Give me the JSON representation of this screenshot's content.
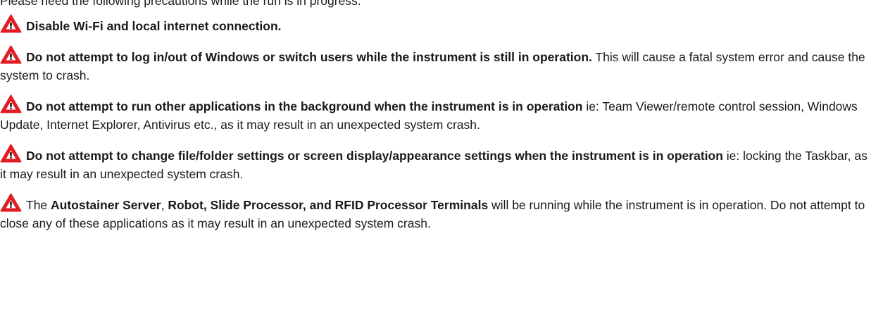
{
  "intro": "Please heed the following precautions while the run is in progress.",
  "warning_icon": "warning-triangle-icon",
  "colors": {
    "icon_fill": "#e31b23",
    "icon_mark": "#000000",
    "text": "#1a1a1a"
  },
  "warnings": [
    {
      "bold": "Disable Wi-Fi and local internet connection.",
      "rest": ""
    },
    {
      "bold": "Do not attempt to log in/out of Windows or switch users while the instrument is still in operation.",
      "rest": " This will cause a fatal system error and cause the system to crash."
    },
    {
      "bold": "Do not attempt to run other applications in the background when the instrument is in operation",
      "rest": " ie: Team Viewer/remote control session, Windows Update, Internet Explorer, Antivirus etc., as it may result in an unexpected system crash."
    },
    {
      "bold": "Do not attempt to change file/folder settings or screen display/appearance settings when the instrument is in operation",
      "rest": " ie: locking the Taskbar, as it may result in an unexpected system crash."
    },
    {
      "parts": {
        "t1": "The ",
        "b1": "Autostainer Server",
        "t2": ", ",
        "b2": "Robot, Slide Processor, and RFID Processor Terminals",
        "t3": " will be running while the instrument is in operation. Do not attempt to close any of these applications as it may result in an unexpected system crash."
      }
    }
  ]
}
